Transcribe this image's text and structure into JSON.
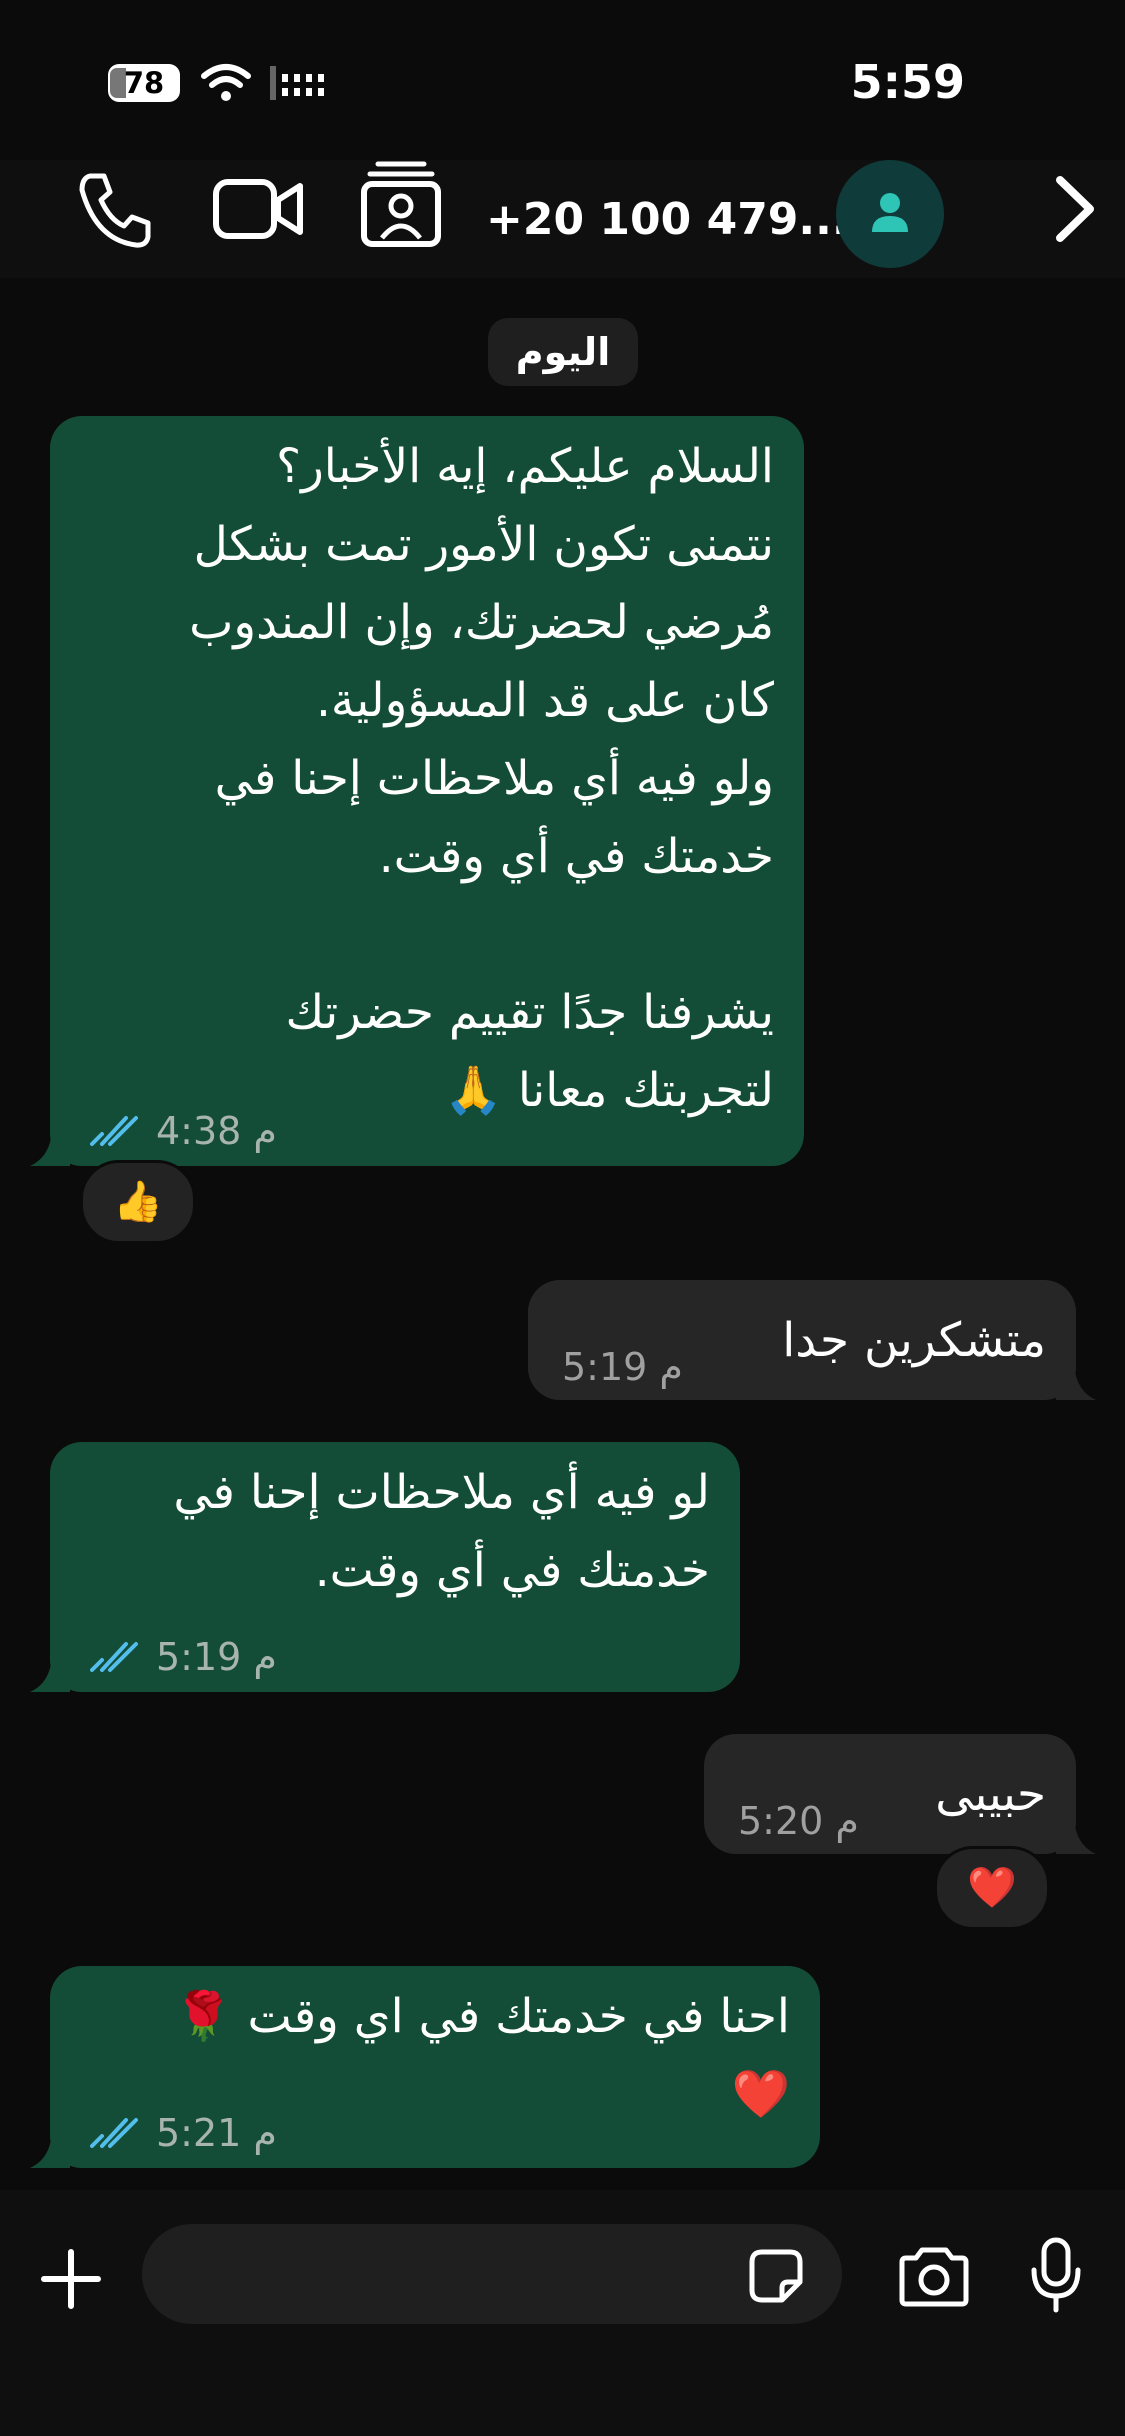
{
  "status_bar": {
    "battery": "78",
    "time": "5:59"
  },
  "header": {
    "contact_name": "+20 100 479..."
  },
  "chat": {
    "date_label": "اليوم",
    "messages": [
      {
        "direction": "outgoing",
        "text": "السلام عليكم، إيه الأخبار؟\nنتمنى تكون الأمور تمت بشكل\nمُرضي لحضرتك، وإن المندوب\nكان على قد المسؤولية.\nولو فيه أي ملاحظات إحنا في\nخدمتك في أي وقت.\n\nيشرفنا جدًا تقييم حضرتك\nلتجربتك معانا 🙏",
        "time": "4:38 م",
        "status": "read",
        "reaction": "👍"
      },
      {
        "direction": "incoming",
        "text": "متشكرين جدا",
        "time": "5:19 م"
      },
      {
        "direction": "outgoing",
        "text": "لو فيه أي ملاحظات إحنا في\nخدمتك في أي وقت.",
        "time": "5:19 م",
        "status": "read"
      },
      {
        "direction": "incoming",
        "text": "حبيبى",
        "time": "5:20 م",
        "reaction": "❤️"
      },
      {
        "direction": "outgoing",
        "text": "احنا في خدمتك في اي وقت 🌹\n❤️",
        "time": "5:21 م",
        "status": "read"
      }
    ]
  },
  "input": {
    "placeholder": ""
  },
  "colors": {
    "outgoing_bubble": "#144d37",
    "incoming_bubble": "#262626",
    "read_ticks": "#53bdeb",
    "background": "#0b0b0b"
  },
  "icons": {
    "header": [
      "back-chevron-icon",
      "avatar-icon",
      "contact-card-icon",
      "video-call-icon",
      "phone-icon"
    ],
    "input": [
      "plus-icon",
      "sticker-icon",
      "camera-icon",
      "microphone-icon"
    ]
  }
}
